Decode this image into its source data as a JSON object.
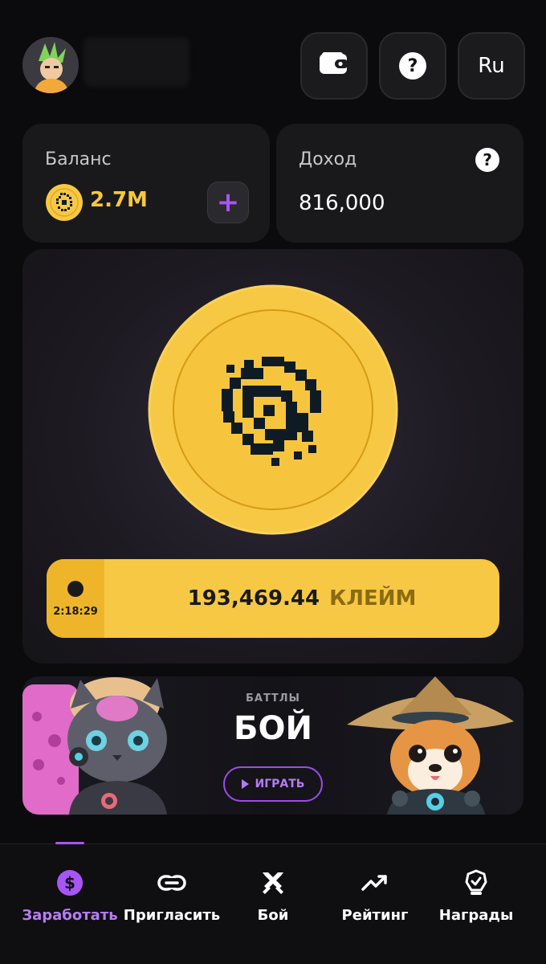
{
  "header": {
    "language": "Ru"
  },
  "balance_card": {
    "label": "Баланс",
    "value": "2.7M",
    "add_label": "+"
  },
  "income_card": {
    "label": "Доход",
    "value": "816,000",
    "help": "?"
  },
  "claim": {
    "timer": "2:18:29",
    "amount": "193,469.44",
    "action": "КЛЕЙМ"
  },
  "battle": {
    "kicker": "БАТТЛЫ",
    "title": "БОЙ",
    "play_label": "ИГРАТЬ"
  },
  "nav": {
    "items": [
      {
        "label": "Заработать",
        "icon": "dollar-icon",
        "active": true
      },
      {
        "label": "Пригласить",
        "icon": "link-icon",
        "active": false
      },
      {
        "label": "Бой",
        "icon": "swords-icon",
        "active": false
      },
      {
        "label": "Рейтинг",
        "icon": "trending-up-icon",
        "active": false
      },
      {
        "label": "Награды",
        "icon": "award-badge-icon",
        "active": false
      }
    ]
  },
  "colors": {
    "accent_purple": "#a855f7",
    "coin_yellow": "#f7c843",
    "balance_yellow": "#f6c93c"
  }
}
